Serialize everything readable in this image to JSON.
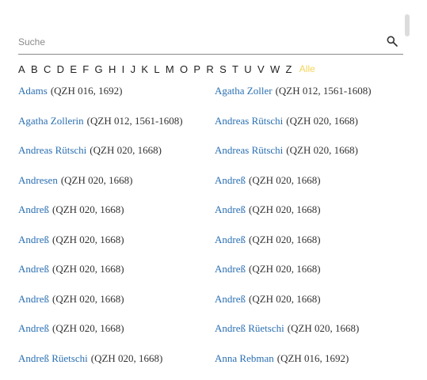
{
  "search": {
    "placeholder": "Suche",
    "icon": "search-icon"
  },
  "alphabet": {
    "letters": [
      "A",
      "B",
      "C",
      "D",
      "E",
      "F",
      "G",
      "H",
      "I",
      "J",
      "K",
      "L",
      "M",
      "O",
      "P",
      "R",
      "S",
      "T",
      "U",
      "V",
      "W",
      "Z"
    ],
    "all_label": "Alle",
    "all_color": "#f5d55a"
  },
  "entries": [
    {
      "left": {
        "name": "Adams",
        "meta": "(QZH 016, 1692)"
      },
      "right": {
        "name": "Agatha Zoller",
        "meta": "(QZH 012, 1561-1608)"
      }
    },
    {
      "left": {
        "name": "Agatha Zollerin",
        "meta": "(QZH 012, 1561-1608)"
      },
      "right": {
        "name": "Andreas Rütschi",
        "meta": "(QZH 020, 1668)"
      }
    },
    {
      "left": {
        "name": "Andreas Rütschi",
        "meta": "(QZH 020, 1668)"
      },
      "right": {
        "name": "Andreas Rütschi",
        "meta": "(QZH 020, 1668)"
      }
    },
    {
      "left": {
        "name": "Andresen",
        "meta": "(QZH 020, 1668)"
      },
      "right": {
        "name": "Andreß",
        "meta": "(QZH 020, 1668)"
      }
    },
    {
      "left": {
        "name": "Andreß",
        "meta": "(QZH 020, 1668)"
      },
      "right": {
        "name": "Andreß",
        "meta": "(QZH 020, 1668)"
      }
    },
    {
      "left": {
        "name": "Andreß",
        "meta": "(QZH 020, 1668)"
      },
      "right": {
        "name": "Andreß",
        "meta": "(QZH 020, 1668)"
      }
    },
    {
      "left": {
        "name": "Andreß",
        "meta": "(QZH 020, 1668)"
      },
      "right": {
        "name": "Andreß",
        "meta": "(QZH 020, 1668)"
      }
    },
    {
      "left": {
        "name": "Andreß",
        "meta": "(QZH 020, 1668)"
      },
      "right": {
        "name": "Andreß",
        "meta": "(QZH 020, 1668)"
      }
    },
    {
      "left": {
        "name": "Andreß",
        "meta": "(QZH 020, 1668)"
      },
      "right": {
        "name": "Andreß Rüetschi",
        "meta": "(QZH 020, 1668)"
      }
    },
    {
      "left": {
        "name": "Andreß Rüetschi",
        "meta": "(QZH 020, 1668)"
      },
      "right": {
        "name": "Anna Rebman",
        "meta": "(QZH 016, 1692)"
      }
    }
  ],
  "colors": {
    "link": "#2a6fb2",
    "text": "#333333",
    "accent": "#f5d55a"
  }
}
